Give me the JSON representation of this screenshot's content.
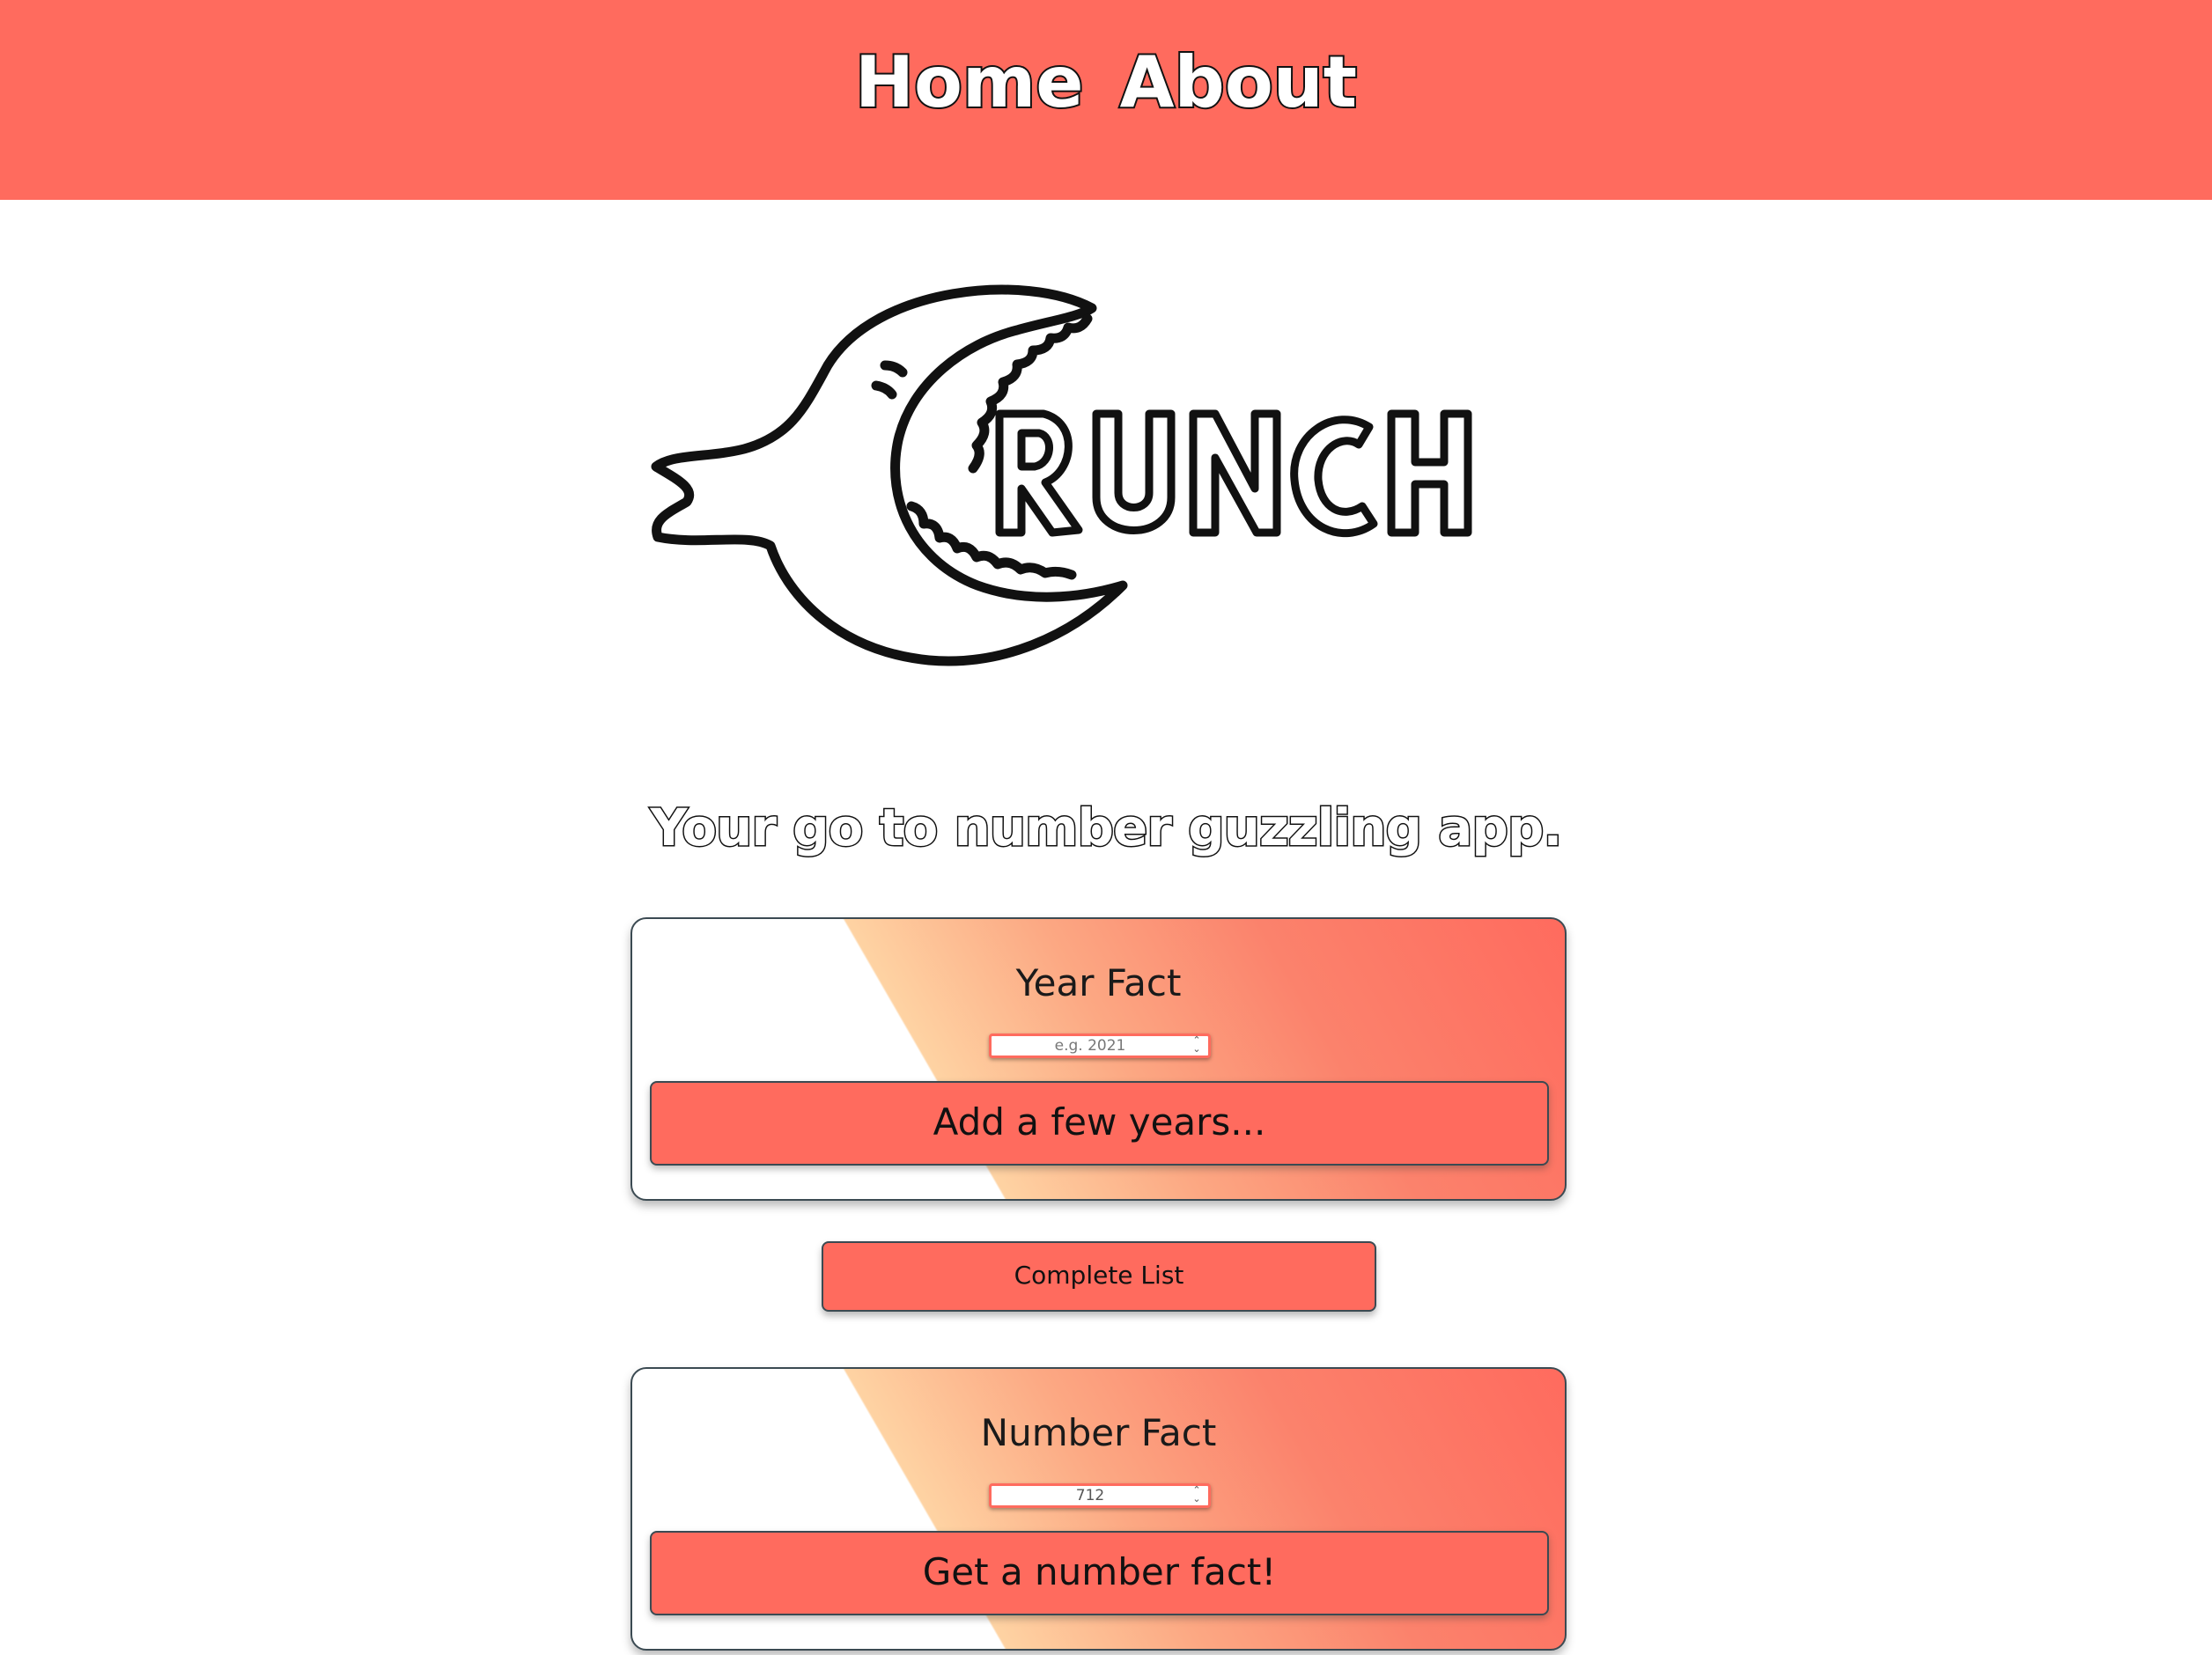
{
  "nav": {
    "items": [
      {
        "label": "Home"
      },
      {
        "label": "About"
      }
    ]
  },
  "logo": {
    "icon": "crunch-moon-mascot-icon",
    "wordmark": "RUNCH"
  },
  "tagline": "Your go to number guzzling app.",
  "year_card": {
    "title": "Year Fact",
    "input_value": "",
    "input_placeholder": "e.g. 2021",
    "button_label": "Add a few years..."
  },
  "complete_list_label": "Complete List",
  "number_card": {
    "title": "Number Fact",
    "input_value": "712",
    "input_placeholder": "",
    "button_label": "Get a number fact!"
  },
  "colors": {
    "accent": "#ff6b5e",
    "gradient_light": "#fed3a3",
    "border": "#3b4a52"
  }
}
